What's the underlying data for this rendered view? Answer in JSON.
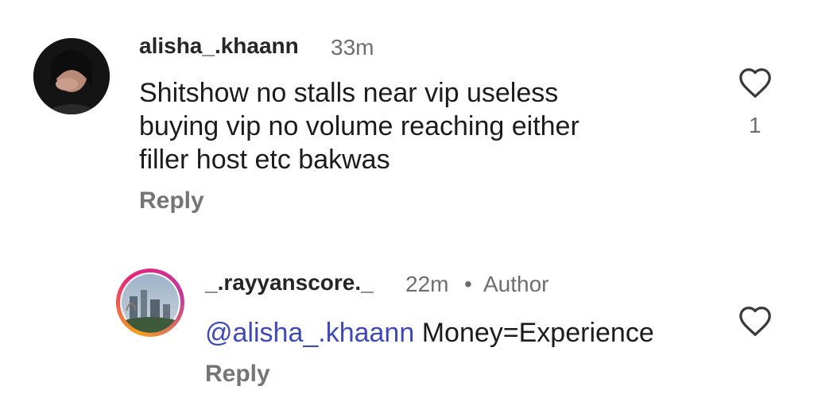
{
  "comment": {
    "username": "alisha_.khaann",
    "time": "33m",
    "text_lines": [
      "Shitshow no stalls near vip useless",
      "buying vip no volume reaching either",
      "filler host etc bakwas"
    ],
    "reply_label": "Reply",
    "like_count": "1",
    "like_icon": "heart-outline-icon"
  },
  "reply": {
    "username": "_.rayyanscore._",
    "time": "22m",
    "separator": "•",
    "author_badge": "Author",
    "mention": "@alisha_.khaann",
    "text": "Money=Experience",
    "reply_label": "Reply",
    "like_icon": "heart-outline-icon"
  },
  "colors": {
    "mention": "#3f4ab8",
    "story_ring_start": "#f9a21a",
    "story_ring_end": "#e8237b"
  }
}
